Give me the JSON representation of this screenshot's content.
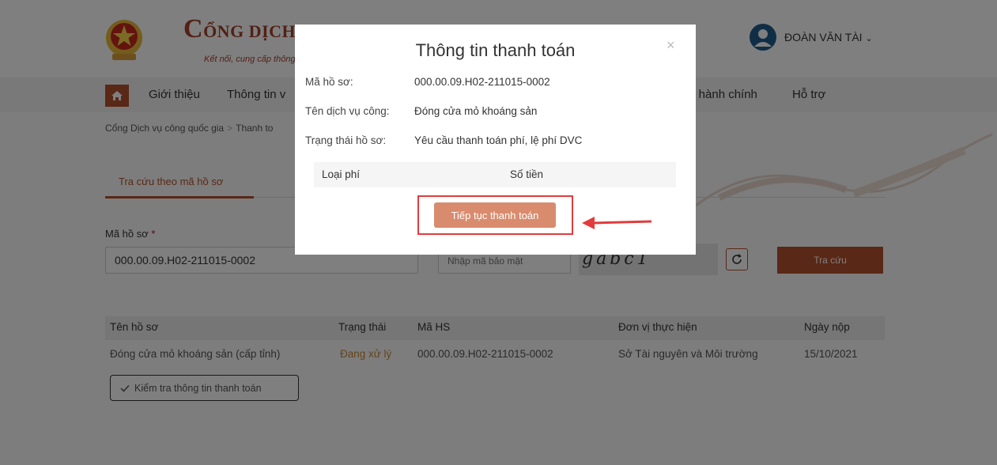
{
  "header": {
    "logo_title": "ỔNG DỊCH V",
    "logo_title_initial": "C",
    "logo_subtitle": "Kết nối, cung cấp thông",
    "user_name": "ĐOÀN VĂN TÀI"
  },
  "nav": {
    "items": [
      {
        "label": "Giới thiệu"
      },
      {
        "label": "Thông tin v"
      },
      {
        "label": "c hành chính"
      },
      {
        "label": "Hỗ trợ"
      }
    ]
  },
  "breadcrumb": {
    "home": "Cổng Dịch vụ công quốc gia",
    "separator": ">",
    "current": "Thanh to"
  },
  "tabs": [
    {
      "label": "Tra cứu theo mã hồ sơ",
      "active": true
    }
  ],
  "search": {
    "field_label": "Mã hồ sơ",
    "required_mark": "*",
    "ma_value": "000.00.09.H02-211015-0002",
    "captcha_placeholder": "Nhập mã bảo mật",
    "captcha_text": "gabc1",
    "button_label": "Tra cứu"
  },
  "table": {
    "columns": [
      "Tên hồ sơ",
      "Trạng thái",
      "Mã HS",
      "Đơn vị thực hiện",
      "Ngày nộp"
    ],
    "rows": [
      {
        "ten": "Đóng cửa mỏ khoáng sản (cấp tỉnh)",
        "trang_thai": "Đang xử lý",
        "ma": "000.00.09.H02-211015-0002",
        "don_vi": "Sở Tài nguyên và Môi trường",
        "ngay": "15/10/2021"
      }
    ],
    "check_button": "Kiểm tra thông tin thanh toán"
  },
  "modal": {
    "title": "Thông tin thanh toán",
    "close": "×",
    "fields": [
      {
        "label": "Mã hồ sơ:",
        "value": "000.00.09.H02-211015-0002"
      },
      {
        "label": "Tên dịch vụ công:",
        "value": "Đóng cửa mỏ khoáng sản"
      },
      {
        "label": "Trạng thái hồ sơ:",
        "value": "Yêu cầu thanh toán phí, lệ phí DVC"
      }
    ],
    "fee_columns": [
      "Loại phí",
      "Số tiền"
    ],
    "continue_button": "Tiếp tục thanh toán"
  },
  "colors": {
    "brand": "#b4512c",
    "highlight": "#e23c3c",
    "status": "#c98a3a"
  }
}
